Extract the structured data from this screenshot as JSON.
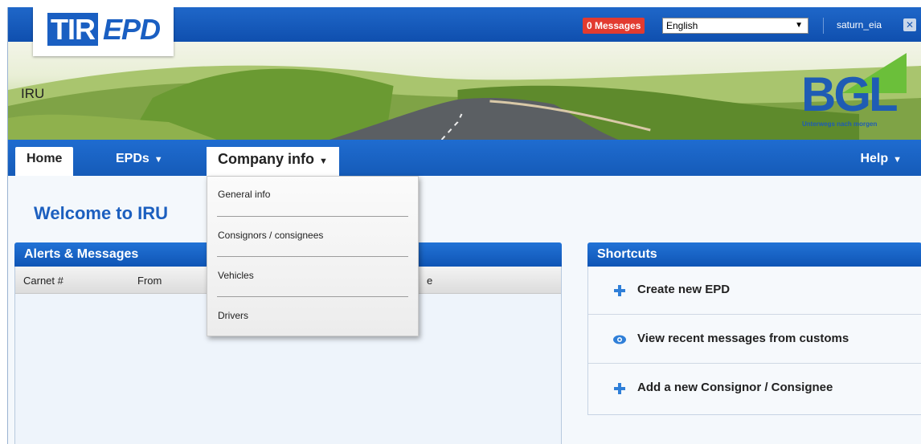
{
  "header": {
    "logo_part1": "TIR",
    "logo_part2": "EPD",
    "messages_badge": "0 Messages",
    "language_value": "English",
    "username": "saturn_eia",
    "logout_icon": "close-icon"
  },
  "banner": {
    "org_name": "IRU",
    "partner_logo": "BGL",
    "partner_slogan": "Unterwegs nach morgen"
  },
  "nav": {
    "home": "Home",
    "epds": "EPDs",
    "company_info": "Company info",
    "help": "Help",
    "caret_icon": "caret-down-icon"
  },
  "company_menu": {
    "items": [
      "General info",
      "Consignors / consignees",
      "Vehicles",
      "Drivers"
    ]
  },
  "main": {
    "welcome_title": "Welcome to IRU",
    "alerts": {
      "title": "Alerts & Messages",
      "columns": [
        "Carnet #",
        "From",
        "e"
      ]
    },
    "shortcuts": {
      "title": "Shortcuts",
      "items": [
        {
          "label": "Create new EPD",
          "icon": "plus-icon"
        },
        {
          "label": "View recent messages from customs",
          "icon": "eye-icon"
        },
        {
          "label": "Add a new Consignor / Consignee",
          "icon": "plus-icon"
        }
      ]
    }
  },
  "colors": {
    "brand_blue": "#1a5fc2",
    "badge_red": "#e23b30"
  }
}
